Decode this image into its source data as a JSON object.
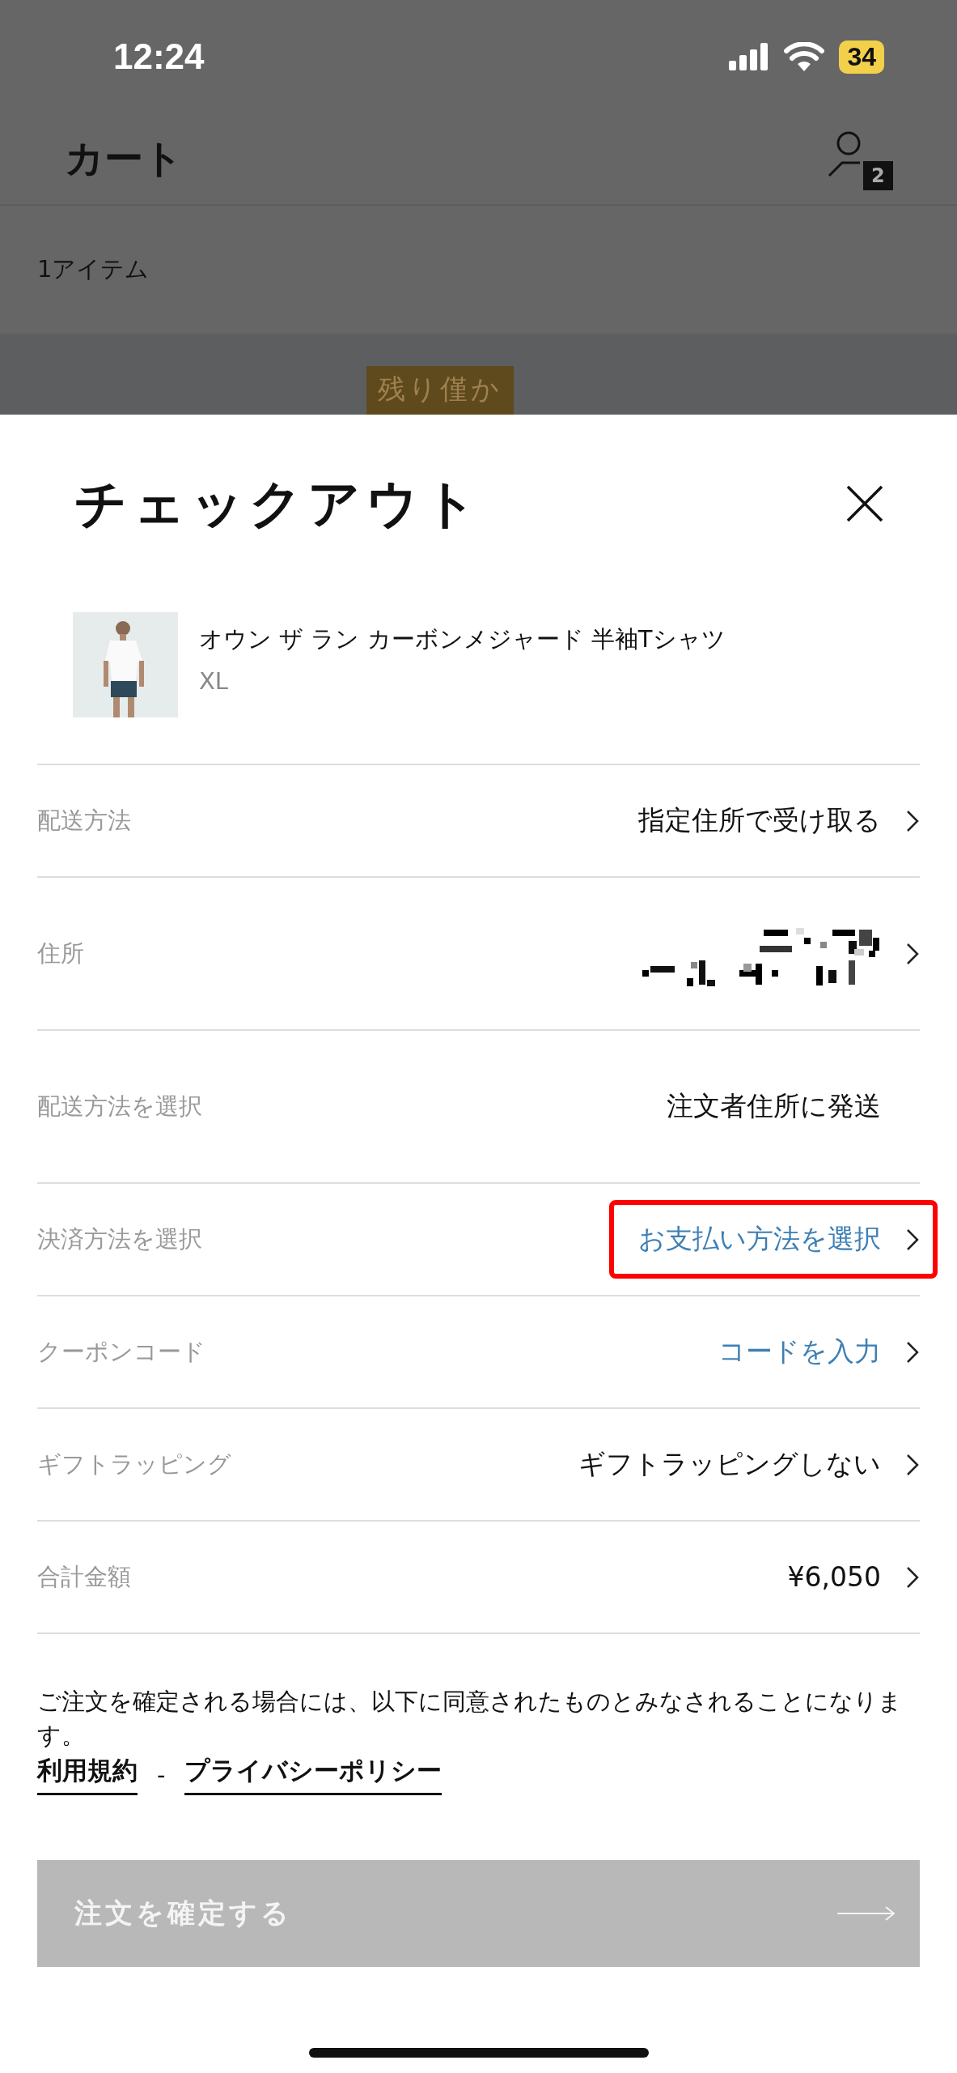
{
  "status_bar": {
    "time": "12:24",
    "battery": "34"
  },
  "header": {
    "title": "カート",
    "account_badge": "2"
  },
  "cart": {
    "item_count": "1アイテム",
    "stock_badge": "残り僅か"
  },
  "checkout": {
    "title": "チェックアウト",
    "product": {
      "kind": "picture",
      "name": "オウン ザ ラン カーボンメジャード 半袖Tシャツ",
      "size": "XL"
    },
    "rows": [
      {
        "label": "配送方法",
        "kind": "value",
        "value": "指定住所で受け取る",
        "chevron": true,
        "highlighted": false
      },
      {
        "label": "住所",
        "kind": "redacted",
        "chevron": true,
        "highlighted": false
      },
      {
        "label": "配送方法を選択",
        "kind": "value",
        "value": "注文者住所に発送",
        "chevron": false,
        "highlighted": false
      },
      {
        "label": "決済方法を選択",
        "kind": "link",
        "value": "お支払い方法を選択",
        "chevron": true,
        "highlighted": true
      },
      {
        "label": "クーポンコード",
        "kind": "link",
        "value": "コードを入力",
        "chevron": true,
        "highlighted": false
      },
      {
        "label": "ギフトラッピング",
        "kind": "value",
        "value": "ギフトラッピングしない",
        "chevron": true,
        "highlighted": false
      },
      {
        "label": "合計金額",
        "kind": "value",
        "value": "¥6,050",
        "chevron": true,
        "highlighted": false
      }
    ],
    "notice": "ご注文を確定される場合には、以下に同意されたものとみなされることになります。",
    "links": [
      "利用規約",
      "プライバシーポリシー"
    ],
    "separator": "-",
    "submit": {
      "label": "注文を確定する",
      "disabled": true
    }
  }
}
